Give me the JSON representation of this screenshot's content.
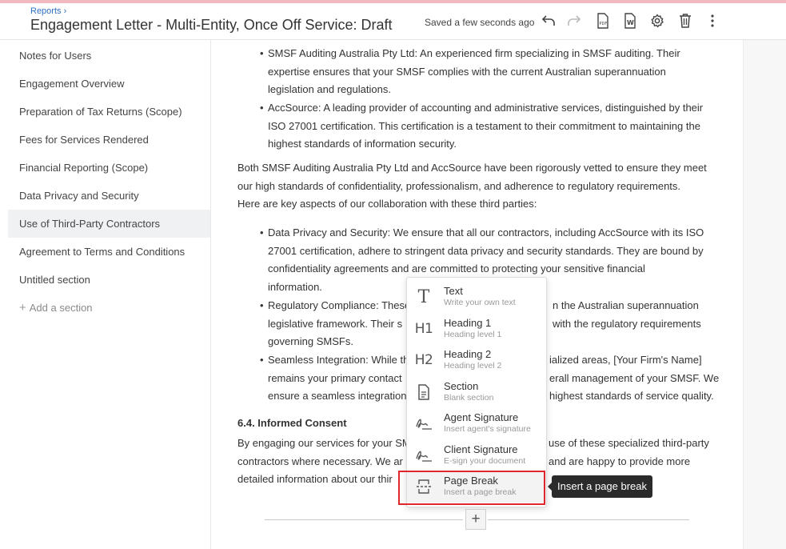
{
  "header": {
    "breadcrumb": "Reports ›",
    "title": "Engagement Letter - Multi-Entity, Once Off Service: Draft",
    "saved_status": "Saved a few seconds ago",
    "actions": [
      "reply-undo-icon",
      "redo-icon",
      "pdf-file-icon",
      "word-file-icon",
      "gear-icon",
      "trash-icon",
      "more-vertical-icon"
    ]
  },
  "sidebar": {
    "items": [
      {
        "label": "Notes for Users"
      },
      {
        "label": "Engagement Overview"
      },
      {
        "label": "Preparation of Tax Returns (Scope)"
      },
      {
        "label": "Fees for Services Rendered"
      },
      {
        "label": "Financial Reporting (Scope)"
      },
      {
        "label": "Data Privacy and Security"
      },
      {
        "label": "Use of Third-Party Contractors",
        "active": true
      },
      {
        "label": "Agreement to Terms and Conditions"
      },
      {
        "label": "Untitled section"
      }
    ],
    "add_label": "Add a section"
  },
  "doc": {
    "b1_l1": "SMSF Auditing Australia Pty Ltd: An experienced firm specializing in SMSF auditing. Their",
    "b1_l2": "expertise ensures that your SMSF complies with the current Australian superannuation",
    "b1_l3": "legislation and regulations.",
    "b2_l1": "AccSource: A leading provider of accounting and administrative services, distinguished by their",
    "b2_l2": "ISO 27001 certification. This certification is a testament to their commitment to maintaining the",
    "b2_l3": "highest standards of information security.",
    "p1_l1": "Both SMSF Auditing Australia Pty Ltd and AccSource have been rigorously vetted to ensure they meet",
    "p1_l2": "our high standards of confidentiality, professionalism, and adherence to regulatory requirements.",
    "p1_l3": "Here are key aspects of our collaboration with these third parties:",
    "b3_l1": "Data Privacy and Security: We ensure that all our contractors, including AccSource with its ISO",
    "b3_l2": "27001 certification, adhere to stringent data privacy and security standards. They are bound by",
    "b3_l3": "confidentiality agreements and are committed to protecting your sensitive financial",
    "b3_l4": "information.",
    "b4_l1a": "Regulatory Compliance: These",
    "b4_l1b": "n the Australian superannuation",
    "b4_l2a": "legislative framework. Their s",
    "b4_l2b": "with the regulatory requirements",
    "b4_l3": "governing SMSFs.",
    "b5_l1a": "Seamless Integration: While th",
    "b5_l1b": "ialized areas, [Your Firm's Name]",
    "b5_l2a": "remains your primary contact",
    "b5_l2b": "erall management of your SMSF. We",
    "b5_l3a": "ensure a seamless integration",
    "b5_l3b": "highest standards of service quality.",
    "heading": "6.4. Informed Consent",
    "p2_l1a": "By engaging our services for your SM",
    "p2_l1b": "use of these specialized third-party",
    "p2_l2a": "contractors where necessary. We ar",
    "p2_l2b": "and are happy to provide more",
    "p2_l3a": "detailed information about our thir"
  },
  "insert_menu": {
    "items": [
      {
        "title": "Text",
        "subtitle": "Write your own text",
        "icon": "text-type-icon"
      },
      {
        "title": "Heading 1",
        "subtitle": "Heading level 1",
        "icon": "heading-1-icon"
      },
      {
        "title": "Heading 2",
        "subtitle": "Heading level 2",
        "icon": "heading-2-icon"
      },
      {
        "title": "Section",
        "subtitle": "Blank section",
        "icon": "document-section-icon"
      },
      {
        "title": "Agent Signature",
        "subtitle": "Insert agent's signature",
        "icon": "signature-icon"
      },
      {
        "title": "Client Signature",
        "subtitle": "E-sign your document",
        "icon": "signature-icon"
      },
      {
        "title": "Page Break",
        "subtitle": "Insert a page break",
        "icon": "page-break-icon"
      }
    ],
    "tooltip": "Insert a page break",
    "add_button": "+"
  }
}
